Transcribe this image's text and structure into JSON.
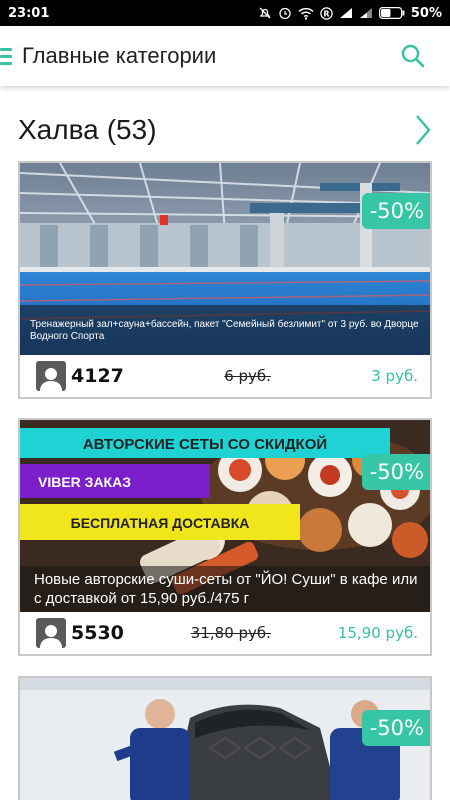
{
  "status_bar": {
    "time": "23:01",
    "battery_percent": "50%",
    "icons": [
      "mute-icon",
      "alarm-icon",
      "wifi-icon",
      "registered-icon",
      "signal-icon",
      "signal-icon",
      "battery-icon"
    ],
    "battery_level": 0.5
  },
  "app_bar": {
    "title": "Главные категории",
    "menu_icon": "menu-icon",
    "search_icon": "search-icon",
    "accent_color": "#36c2a3"
  },
  "section": {
    "title": "Халва",
    "count": "(53)",
    "arrow_icon": "chevron-right-icon"
  },
  "cards": [
    {
      "discount": "-50%",
      "caption": "Тренажерный зал+сауна+бассейн, пакет \"Семейный безлимит\" от 3 руб. во Дворце Водного Спорта",
      "count": "4127",
      "old_price": "6 руб.",
      "new_price": "3 руб.",
      "image": "indoor-pool-photo"
    },
    {
      "discount": "-50%",
      "banner_lines": [
        "АВТОРСКИЕ СЕТЫ СО СКИДКОЙ",
        "VIBER ЗАКАЗ",
        "БЕСПЛАТНАЯ ДОСТАВКА"
      ],
      "caption": "Новые авторские суши-сеты от \"ЙО! Суши\" в кафе или с доставкой от 15,90 руб./475 г",
      "count": "5530",
      "old_price": "31,80 руб.",
      "new_price": "15,90 руб.",
      "image": "sushi-photo"
    },
    {
      "discount": "-50%",
      "image": "car-mechanics-photo"
    }
  ]
}
